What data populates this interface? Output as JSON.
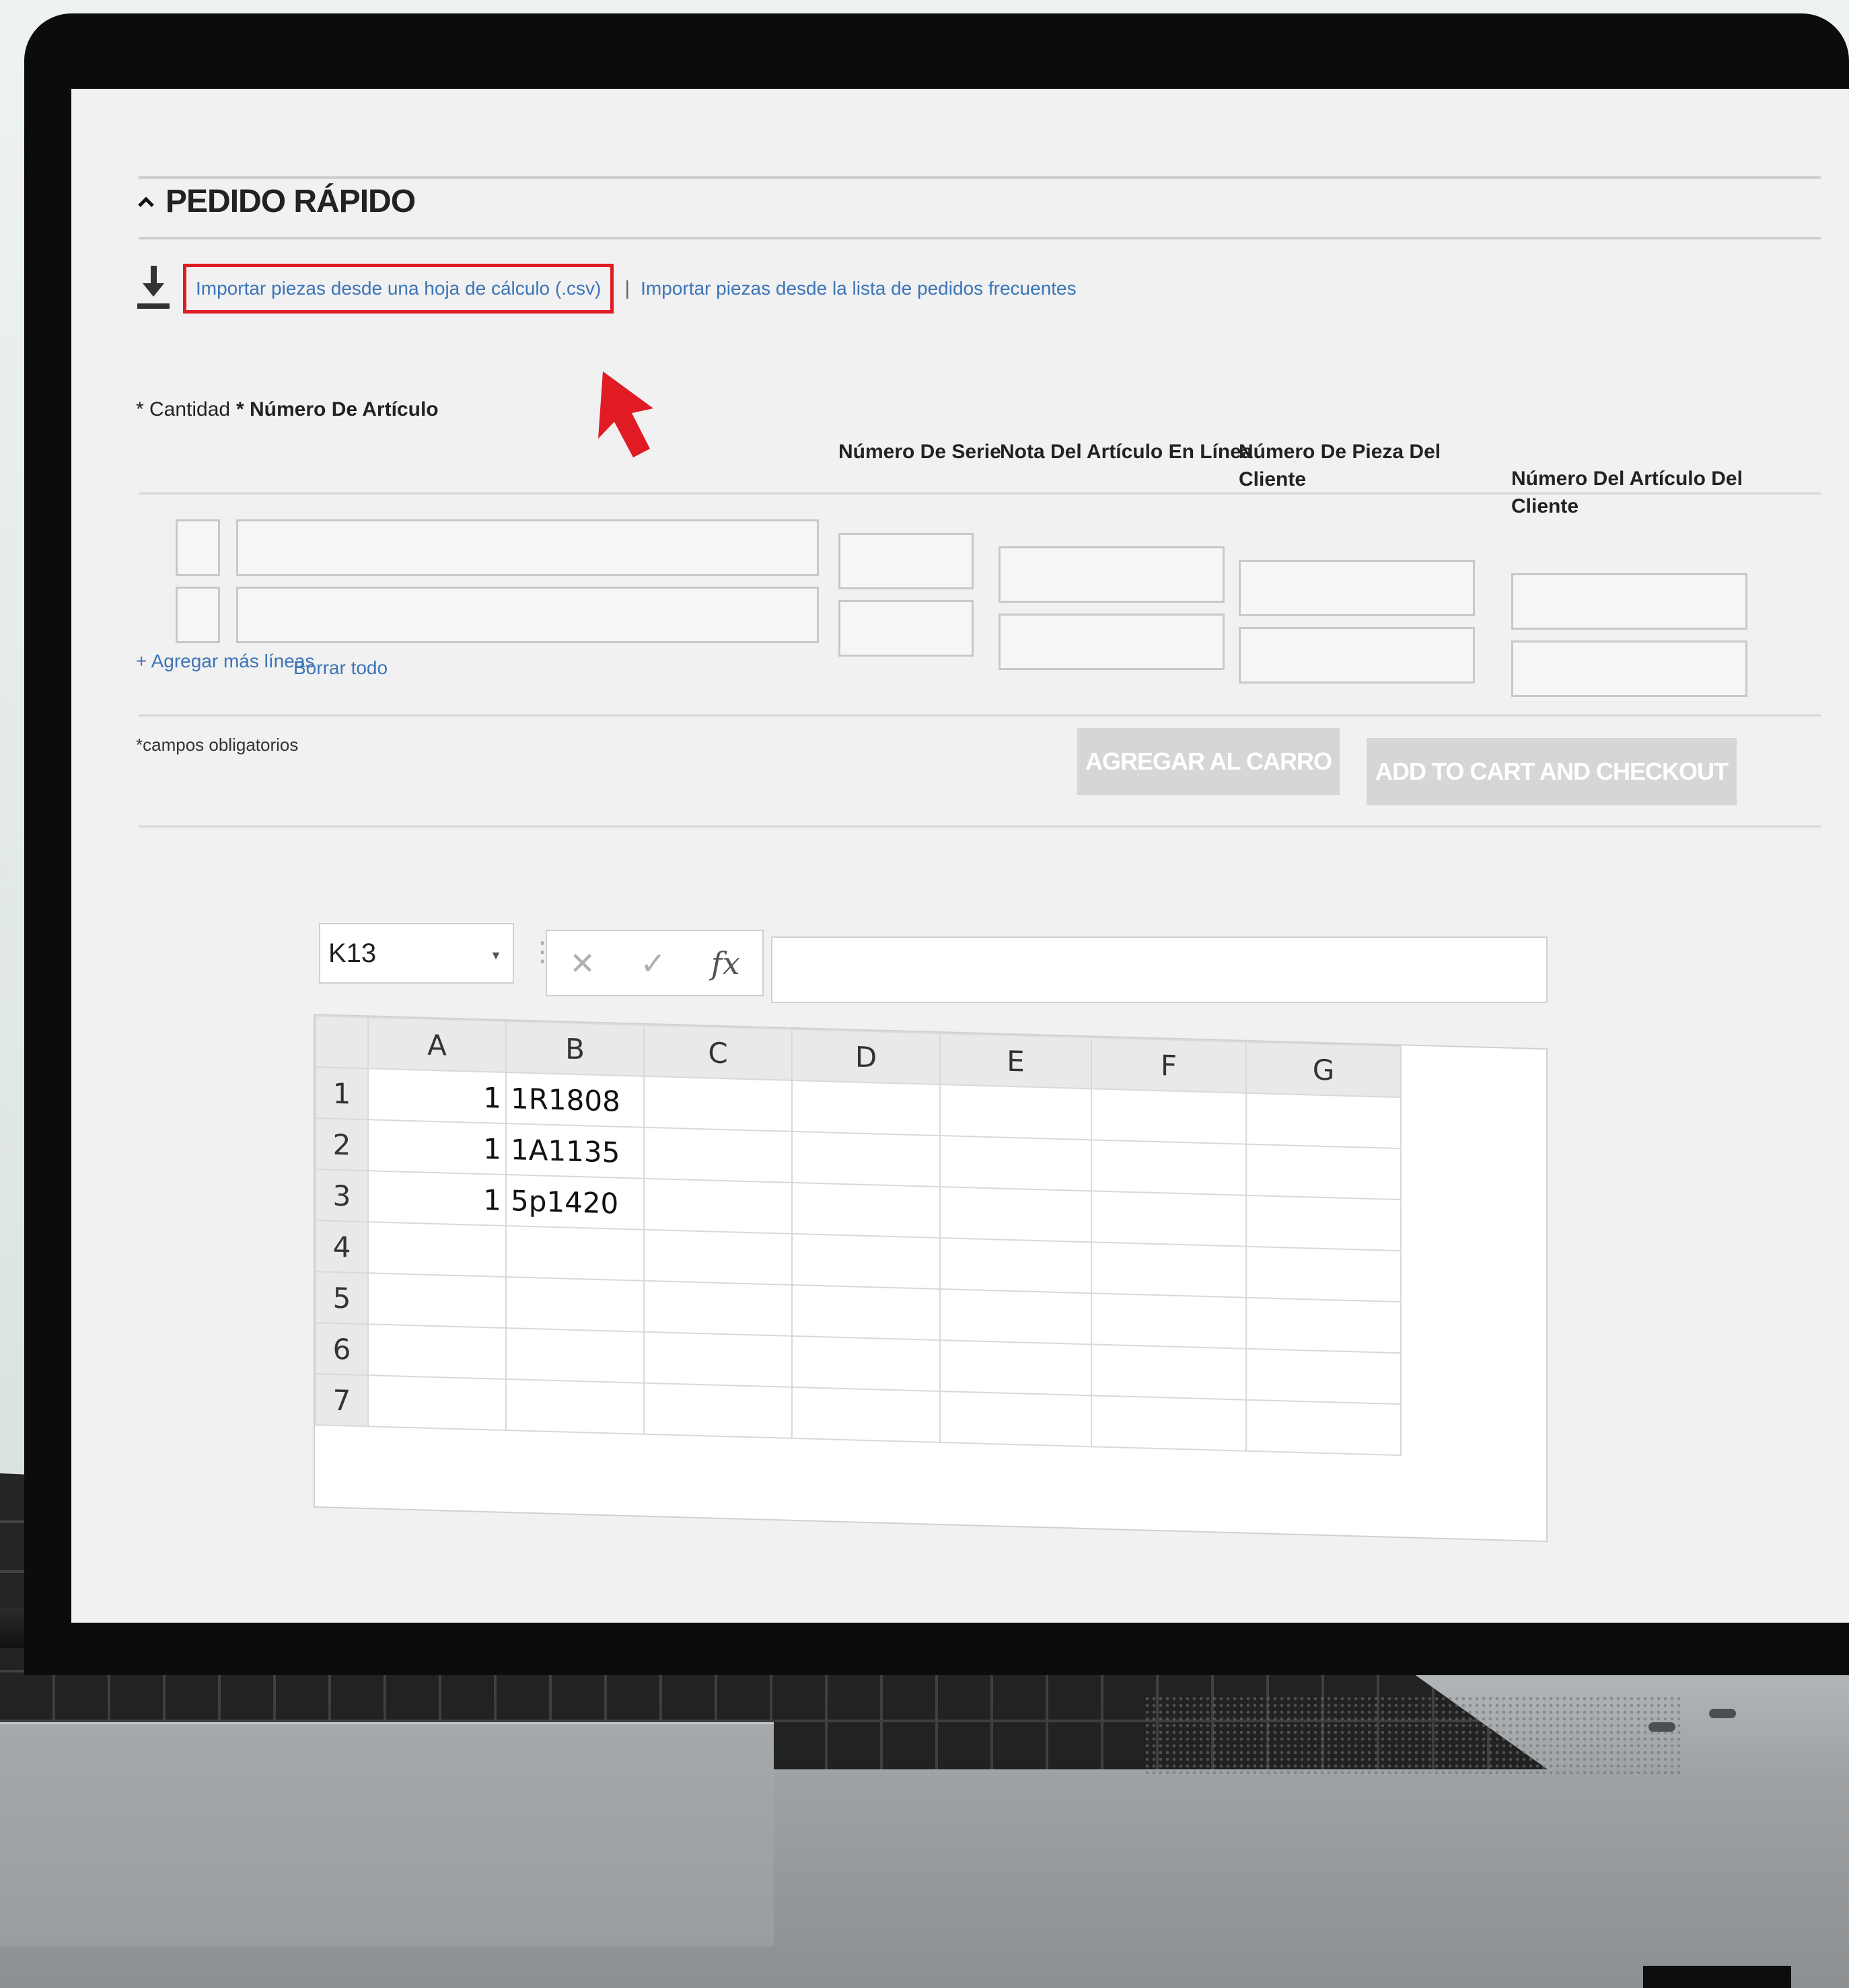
{
  "form": {
    "section_title": "PEDIDO RÁPIDO",
    "import_csv_link": "Importar piezas desde una hoja de cálculo (.csv)",
    "link_separator": "|",
    "import_frequent_link": "Importar piezas desde la lista de pedidos frecuentes",
    "labels": {
      "quantity": "* Cantidad",
      "article_number": "* Número De Artículo",
      "serial_number": "Número De Serie",
      "line_item_note": "Nota Del Artículo En Línea",
      "client_piece_number": "Número De Pieza Del Cliente",
      "client_article_number": "Número Del Artículo Del Cliente"
    },
    "add_lines_link": "+ Agregar más líneas",
    "clear_all_link": "Borrar todo",
    "required_note": "*campos obligatorios",
    "add_to_cart_button": "AGREGAR AL CARRO",
    "add_to_cart_checkout_button": "ADD TO CART AND CHECKOUT",
    "accent_color": "#e01b24",
    "link_color": "#3c74b8"
  },
  "spreadsheet": {
    "name_box": "K13",
    "fx_label": "fx",
    "columns": [
      "A",
      "B",
      "C",
      "D",
      "E",
      "F",
      "G"
    ],
    "rows": [
      {
        "n": "1",
        "a": "1",
        "b": "1R1808"
      },
      {
        "n": "2",
        "a": "1",
        "b": "1A1135"
      },
      {
        "n": "3",
        "a": "1",
        "b": "5p1420"
      },
      {
        "n": "4",
        "a": "",
        "b": ""
      },
      {
        "n": "5",
        "a": "",
        "b": ""
      },
      {
        "n": "6",
        "a": "",
        "b": ""
      },
      {
        "n": "7",
        "a": "",
        "b": ""
      }
    ]
  }
}
